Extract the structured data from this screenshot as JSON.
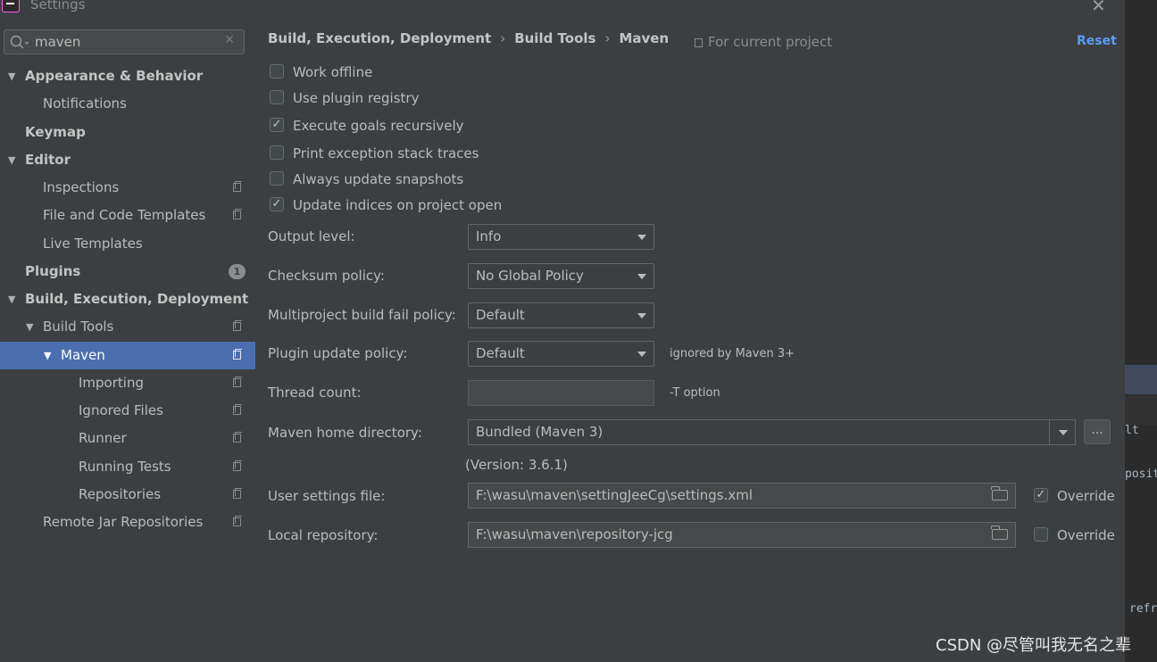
{
  "window": {
    "title": "Settings"
  },
  "search": {
    "value": "maven"
  },
  "tree": [
    {
      "label": "Appearance & Behavior",
      "bold": true,
      "expanded": true,
      "indent": 0
    },
    {
      "label": "Notifications",
      "indent": 1
    },
    {
      "label": "Keymap",
      "bold": true,
      "indent": 0
    },
    {
      "label": "Editor",
      "bold": true,
      "expanded": true,
      "indent": 0
    },
    {
      "label": "Inspections",
      "indent": 1,
      "project_icon": true
    },
    {
      "label": "File and Code Templates",
      "indent": 1,
      "project_icon": true
    },
    {
      "label": "Live Templates",
      "indent": 1
    },
    {
      "label": "Plugins",
      "bold": true,
      "indent": 0,
      "badge": "1"
    },
    {
      "label": "Build, Execution, Deployment",
      "bold": true,
      "expanded": true,
      "indent": 0
    },
    {
      "label": "Build Tools",
      "expanded": true,
      "indent": 1,
      "project_icon": true
    },
    {
      "label": "Maven",
      "expanded": true,
      "indent": 2,
      "project_icon": true,
      "selected": true
    },
    {
      "label": "Importing",
      "indent": 3,
      "project_icon": true
    },
    {
      "label": "Ignored Files",
      "indent": 3,
      "project_icon": true
    },
    {
      "label": "Runner",
      "indent": 3,
      "project_icon": true
    },
    {
      "label": "Running Tests",
      "indent": 3,
      "project_icon": true
    },
    {
      "label": "Repositories",
      "indent": 3,
      "project_icon": true
    },
    {
      "label": "Remote Jar Repositories",
      "indent": 1,
      "project_icon": true
    }
  ],
  "breadcrumb": [
    "Build, Execution, Deployment",
    "Build Tools",
    "Maven"
  ],
  "scope_label": "For current project",
  "reset_label": "Reset",
  "checkboxes": [
    {
      "label": "Work offline",
      "checked": false
    },
    {
      "label": "Use plugin registry",
      "checked": false
    },
    {
      "label": "Execute goals recursively",
      "checked": true
    },
    {
      "label": "Print exception stack traces",
      "checked": false
    },
    {
      "label": "Always update snapshots",
      "checked": false
    },
    {
      "label": "Update indices on project open",
      "checked": true
    }
  ],
  "fields": {
    "output_level": {
      "label": "Output level:",
      "value": "Info"
    },
    "checksum_policy": {
      "label": "Checksum policy:",
      "value": "No Global Policy"
    },
    "fail_policy": {
      "label": "Multiproject build fail policy:",
      "value": "Default"
    },
    "plugin_update": {
      "label": "Plugin update policy:",
      "value": "Default",
      "hint": "ignored by Maven 3+"
    },
    "thread_count": {
      "label": "Thread count:",
      "value": "",
      "hint": "-T option"
    },
    "maven_home": {
      "label": "Maven home directory:",
      "value": "Bundled (Maven 3)",
      "browse": "...",
      "version": "(Version: 3.6.1)"
    },
    "user_settings": {
      "label": "User settings file:",
      "value": "F:\\wasu\\maven\\settingJeeCg\\settings.xml",
      "override_label": "Override",
      "override": true
    },
    "local_repo": {
      "label": "Local repository:",
      "value": "F:\\wasu\\maven\\repository-jcg",
      "override_label": "Override",
      "override": false
    }
  },
  "background_editor_fragments": [
    "lt",
    "posit",
    "refr"
  ],
  "watermark": "CSDN @尽管叫我无名之辈"
}
